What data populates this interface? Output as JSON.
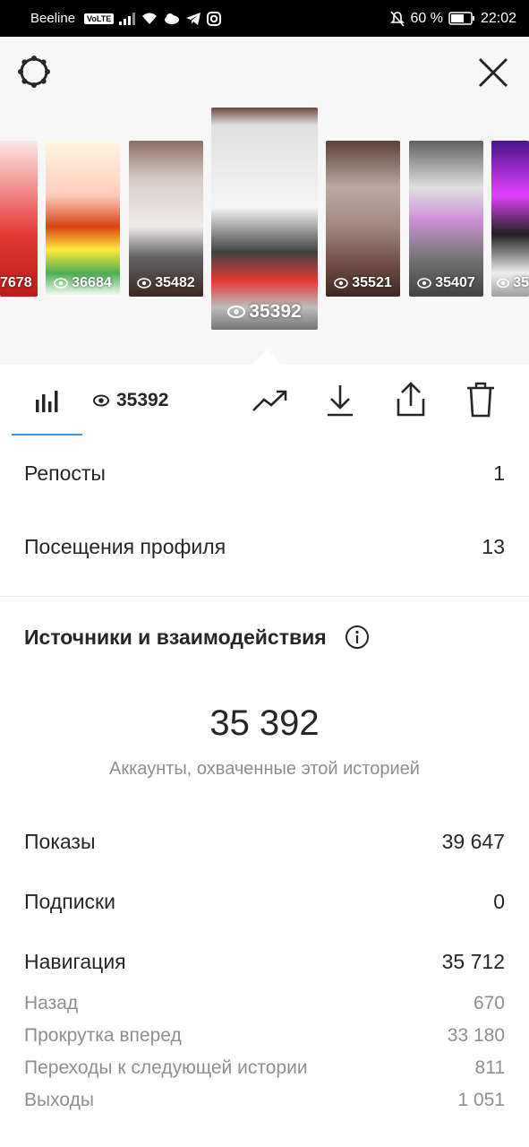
{
  "status_bar": {
    "carrier": "Beeline",
    "volte": "VoLTE",
    "battery": "60 %",
    "time": "22:02"
  },
  "header": {
    "settings_icon": "gear-icon",
    "close_icon": "close-icon"
  },
  "story_thumbnails": [
    {
      "views": "7678"
    },
    {
      "views": "36684"
    },
    {
      "views": "35482"
    },
    {
      "views": "35392",
      "selected": true
    },
    {
      "views": "35521"
    },
    {
      "views": "35407"
    },
    {
      "views": "35"
    }
  ],
  "tabs": {
    "insights_icon": "bar-chart-icon",
    "views_count": "35392",
    "promote_icon": "trending-up-icon",
    "download_icon": "download-icon",
    "share_icon": "share-icon",
    "delete_icon": "trash-icon"
  },
  "stats_top": [
    {
      "label": "Репосты",
      "value": "1"
    },
    {
      "label": "Посещения профиля",
      "value": "13"
    }
  ],
  "discovery": {
    "title": "Источники и взаимодействия",
    "reach_value": "35 392",
    "reach_caption": "Аккаунты, охваченные этой историей"
  },
  "stats_main": [
    {
      "label": "Показы",
      "value": "39 647"
    },
    {
      "label": "Подписки",
      "value": "0"
    },
    {
      "label": "Навигация",
      "value": "35 712"
    }
  ],
  "navigation_details": [
    {
      "label": "Назад",
      "value": "670"
    },
    {
      "label": "Прокрутка вперед",
      "value": "33 180"
    },
    {
      "label": "Переходы к следующей истории",
      "value": "811"
    },
    {
      "label": "Выходы",
      "value": "1 051"
    }
  ],
  "colors": {
    "accent": "#3897f0",
    "text": "#262626",
    "muted": "#8e8e8e"
  }
}
